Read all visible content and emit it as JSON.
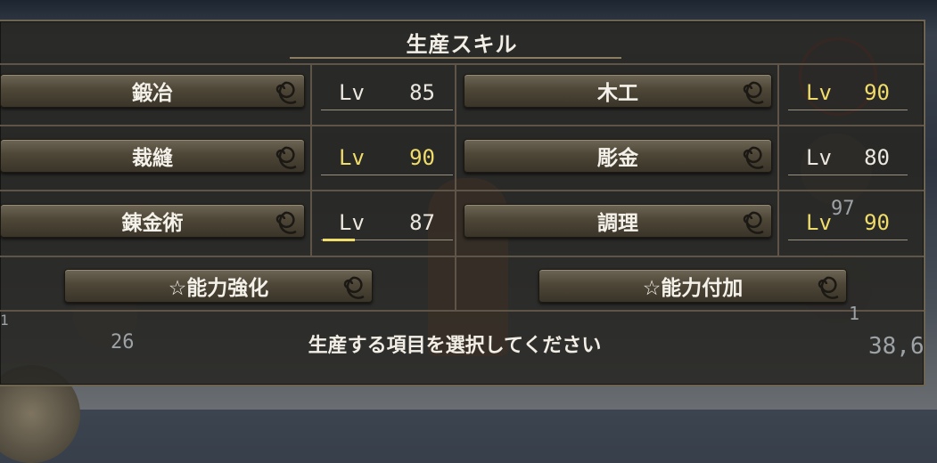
{
  "panel": {
    "title": "生産スキル",
    "message": "生産する項目を選択してください"
  },
  "skills": [
    {
      "name": "鍛冶",
      "lv_label": "Lv",
      "level": "85"
    },
    {
      "name": "木工",
      "lv_label": "Lv",
      "level": "90"
    },
    {
      "name": "裁縫",
      "lv_label": "Lv",
      "level": "90"
    },
    {
      "name": "彫金",
      "lv_label": "Lv",
      "level": "80"
    },
    {
      "name": "錬金術",
      "lv_label": "Lv",
      "level": "87"
    },
    {
      "name": "調理",
      "lv_label": "Lv",
      "level": "90"
    }
  ],
  "actions": {
    "enhance": "☆能力強化",
    "enchant": "☆能力付加"
  },
  "hud": {
    "left_count": "1",
    "item_count_a": "26",
    "item_count_b": "97",
    "item_count_c": "1",
    "coords": "38,6"
  },
  "colors": {
    "max_level": "#f0dc6a",
    "normal_level": "#ece8df"
  }
}
